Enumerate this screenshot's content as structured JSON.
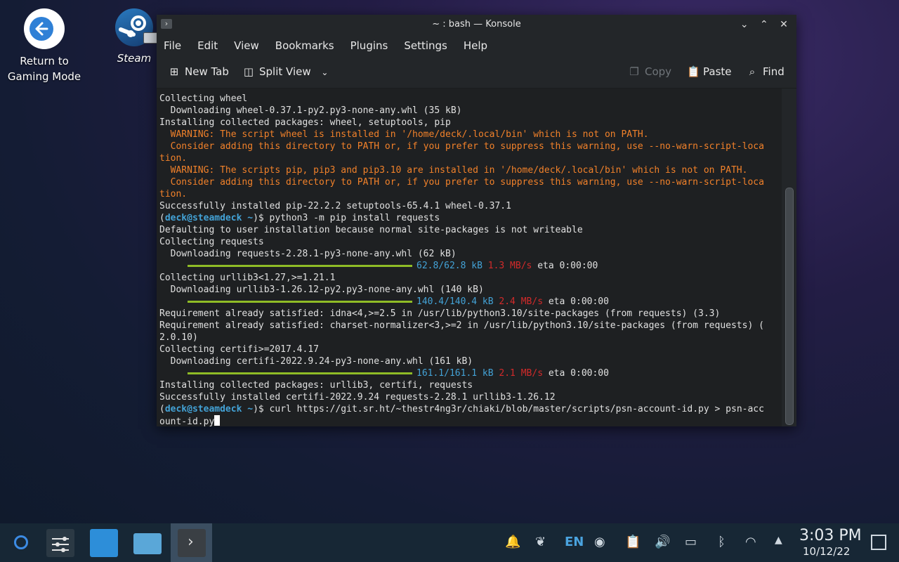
{
  "desktop": {
    "return_label_1": "Return to",
    "return_label_2": "Gaming Mode",
    "steam_label": "Steam"
  },
  "window": {
    "title": "~ : bash — Konsole",
    "menu": [
      "File",
      "Edit",
      "View",
      "Bookmarks",
      "Plugins",
      "Settings",
      "Help"
    ],
    "toolbar": {
      "new_tab": "New Tab",
      "split_view": "Split View",
      "copy": "Copy",
      "paste": "Paste",
      "find": "Find"
    }
  },
  "terminal": {
    "l1": "Collecting wheel",
    "l2": "  Downloading wheel-0.37.1-py2.py3-none-any.whl (35 kB)",
    "l3": "Installing collected packages: wheel, setuptools, pip",
    "l4": "  WARNING: The script wheel is installed in '/home/deck/.local/bin' which is not on PATH.",
    "l5": "  Consider adding this directory to PATH or, if you prefer to suppress this warning, use --no-warn-script-loca",
    "l6": "tion.",
    "l7": "  WARNING: The scripts pip, pip3 and pip3.10 are installed in '/home/deck/.local/bin' which is not on PATH.",
    "l8": "  Consider adding this directory to PATH or, if you prefer to suppress this warning, use --no-warn-script-loca",
    "l9": "tion.",
    "l10": "Successfully installed pip-22.2.2 setuptools-65.4.1 wheel-0.37.1",
    "prompt_user": "deck@steamdeck",
    "prompt_dir": "~",
    "cmd1": "python3 -m pip install requests",
    "l12": "Defaulting to user installation because normal site-packages is not writeable",
    "l13": "Collecting requests",
    "l14": "  Downloading requests-2.28.1-py3-none-any.whl (62 kB)",
    "p1_size": "62.8/62.8 kB",
    "p1_speed": "1.3 MB/s",
    "p1_eta": "eta 0:00:00",
    "l16": "Collecting urllib3<1.27,>=1.21.1",
    "l17": "  Downloading urllib3-1.26.12-py2.py3-none-any.whl (140 kB)",
    "p2_size": "140.4/140.4 kB",
    "p2_speed": "2.4 MB/s",
    "p2_eta": "eta 0:00:00",
    "l19": "Requirement already satisfied: idna<4,>=2.5 in /usr/lib/python3.10/site-packages (from requests) (3.3)",
    "l20": "Requirement already satisfied: charset-normalizer<3,>=2 in /usr/lib/python3.10/site-packages (from requests) (",
    "l21": "2.0.10)",
    "l22": "Collecting certifi>=2017.4.17",
    "l23": "  Downloading certifi-2022.9.24-py3-none-any.whl (161 kB)",
    "p3_size": "161.1/161.1 kB",
    "p3_speed": "2.1 MB/s",
    "p3_eta": "eta 0:00:00",
    "l25": "Installing collected packages: urllib3, certifi, requests",
    "l26": "Successfully installed certifi-2022.9.24 requests-2.28.1 urllib3-1.26.12",
    "cmd2": "curl https://git.sr.ht/~thestr4ng3r/chiaki/blob/master/scripts/psn-account-id.py > psn-acc",
    "l28": "ount-id.py"
  },
  "taskbar": {
    "lang": "EN",
    "time": "3:03 PM",
    "date": "10/12/22"
  }
}
